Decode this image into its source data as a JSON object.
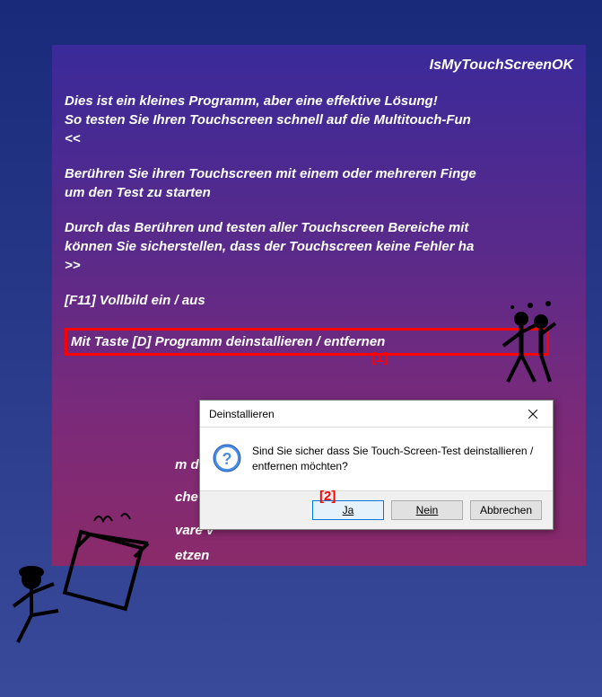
{
  "app": {
    "title": "IsMyTouchScreenOK ",
    "intro1": "Dies ist ein kleines Programm, aber eine effektive Lösung!",
    "intro2": "So testen Sie Ihren Touchscreen schnell auf die Multitouch-Fun",
    "arrow_left": "<<",
    "touch1": "Berühren Sie ihren Touchscreen mit einem oder mehreren Finge",
    "touch2": "um den Test zu starten",
    "test1": "Durch das Berühren und testen aller Touchscreen Bereiche mit",
    "test2": "können Sie sicherstellen, dass der Touchscreen keine Fehler ha",
    "arrow_right": ">>",
    "f11": "[F11] Vollbild ein / aus",
    "uninstall": "Mit Taste [D] Programm deinstallieren / entfernen",
    "partial1": "m de",
    "partial2": "che /",
    "partial3": "vare v",
    "partial4": "etzen"
  },
  "annotations": {
    "a1": "[1]",
    "a2": "[2]"
  },
  "dialog": {
    "title": "Deinstallieren",
    "message": "Sind Sie sicher dass Sie Touch-Screen-Test deinstallieren / entfernen möchten?",
    "yes": "Ja",
    "no": "Nein",
    "cancel": "Abbrechen"
  }
}
